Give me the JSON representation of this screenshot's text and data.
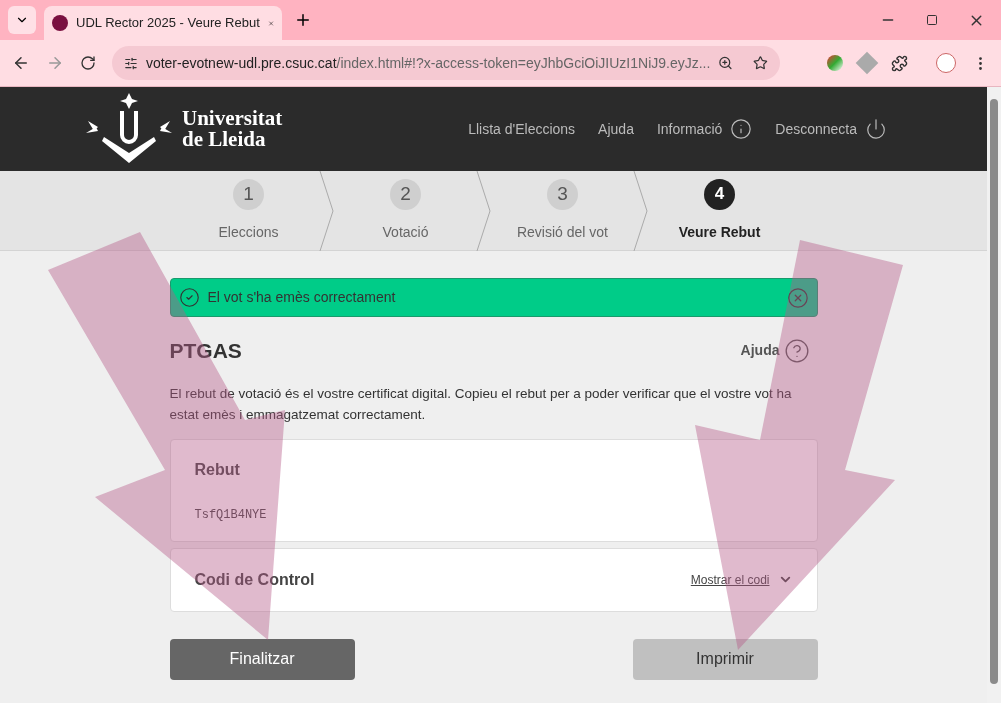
{
  "browser": {
    "tab_title": "UDL Rector 2025 - Veure Rebut",
    "url_host": "voter-evotnew-udl.pre.csuc.cat",
    "url_path": "/index.html#!?x-access-token=eyJhbGciOiJIUzI1NiJ9.eyJz..."
  },
  "header": {
    "logo_lines": [
      "Universitat",
      "de Lleida"
    ],
    "nav": [
      {
        "label": "Llista d'Eleccions",
        "kind": "link"
      },
      {
        "label": "Ajuda",
        "kind": "link"
      },
      {
        "label": "Informació",
        "kind": "info"
      },
      {
        "label": "Desconnecta",
        "kind": "power"
      }
    ]
  },
  "steps": [
    {
      "number": "1",
      "label": "Eleccions",
      "selected": false
    },
    {
      "number": "2",
      "label": "Votació",
      "selected": false
    },
    {
      "number": "3",
      "label": "Revisió del vot",
      "selected": false
    },
    {
      "number": "4",
      "label": "Veure Rebut",
      "selected": true
    }
  ],
  "alert": {
    "text": "El vot s'ha emès correctament"
  },
  "title": "PTGAS",
  "help": "Ajuda",
  "description": "El rebut de votació és el vostre certificat digital. Copieu el rebut per a poder verificar que el vostre vot ha estat emès i emmagatzemat correctament.",
  "receipt": {
    "label": "Rebut",
    "value": "TsfQ1B4NYE"
  },
  "control_code": {
    "label": "Codi de Control",
    "toggle": "Mostrar el codi",
    "expanded": false
  },
  "buttons": [
    {
      "label": "Finalitzar",
      "kind": "primary"
    },
    {
      "label": "Imprimir",
      "kind": "secondary"
    }
  ]
}
